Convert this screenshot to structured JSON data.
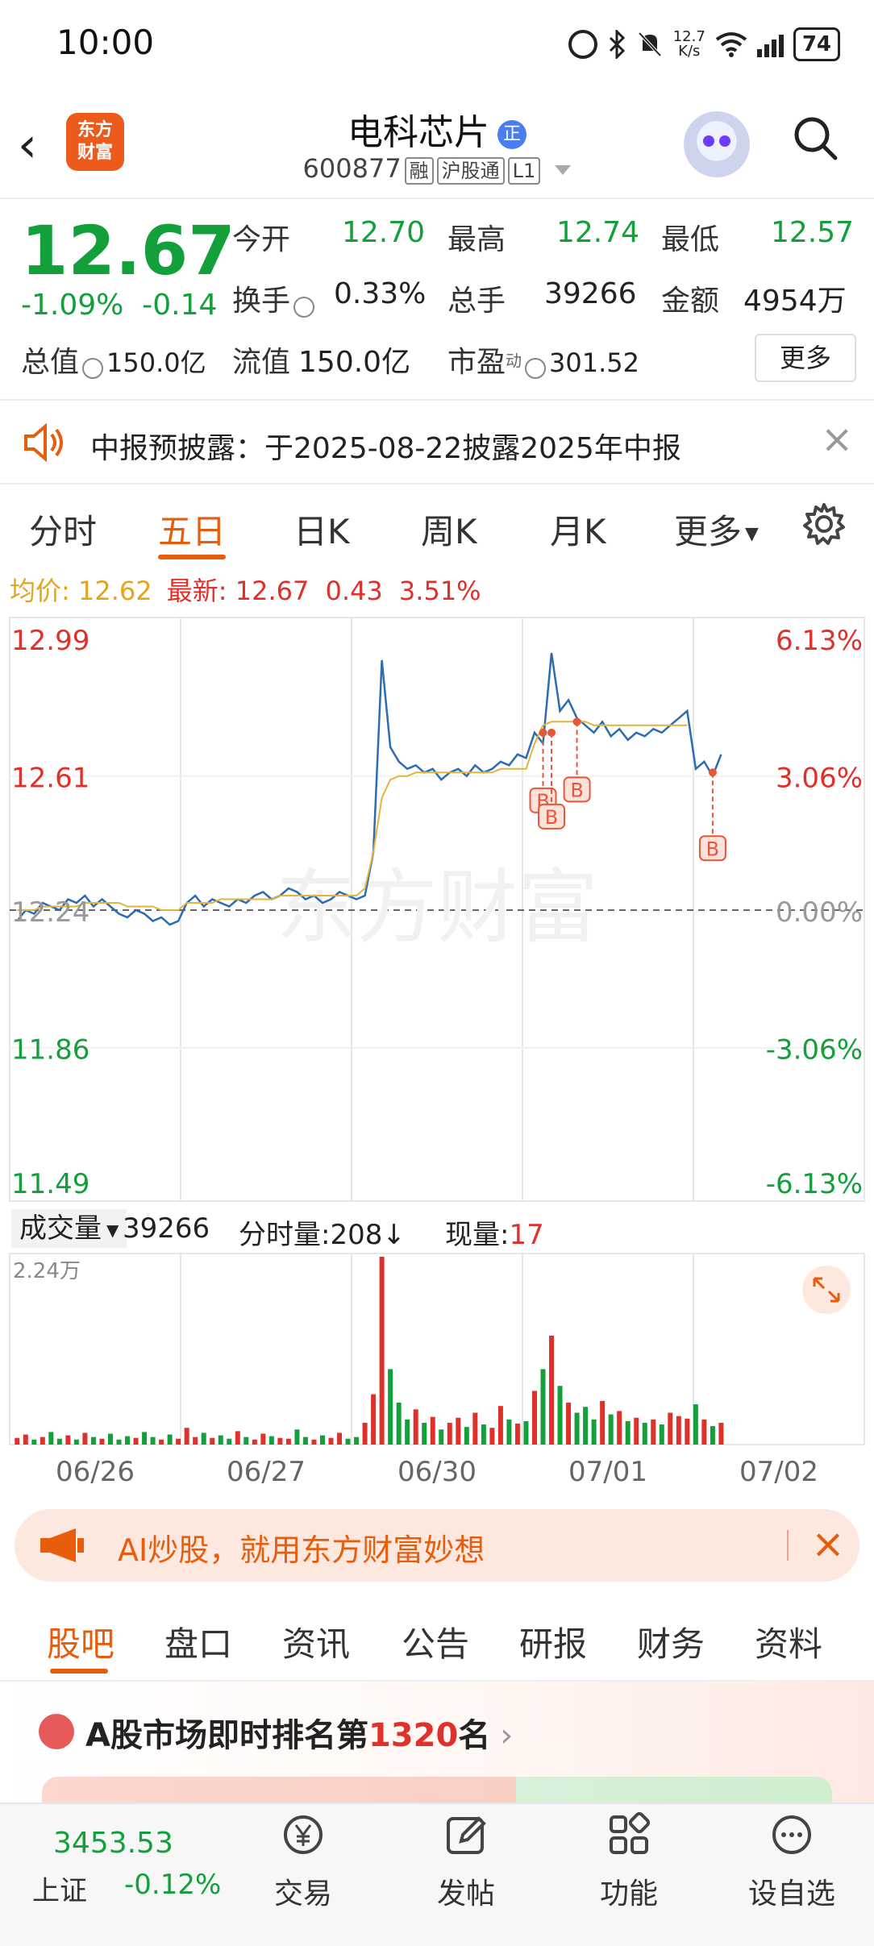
{
  "status_bar": {
    "time": "10:00",
    "speed_top": "12.7",
    "speed_bottom": "K/s",
    "battery": "74"
  },
  "header": {
    "logo_line1": "东方",
    "logo_line2": "财富",
    "stock_name": "电科芯片",
    "badge": "正",
    "stock_code": "600877",
    "tags": [
      "融",
      "沪股通",
      "L1"
    ]
  },
  "quote": {
    "price": "12.67",
    "change_pct": "-1.09%",
    "change_amt": "-0.14",
    "rows": [
      [
        {
          "label": "今开",
          "value": "12.70",
          "color": "green"
        },
        {
          "label": "最高",
          "value": "12.74",
          "color": "green"
        },
        {
          "label": "最低",
          "value": "12.57",
          "color": "green"
        }
      ],
      [
        {
          "label": "换手",
          "value": "0.33%",
          "color": "dark"
        },
        {
          "label": "总手",
          "value": "39266",
          "color": "dark"
        },
        {
          "label": "金额",
          "value": "4954万",
          "color": "dark"
        }
      ]
    ],
    "total_value_label": "总值",
    "total_value": "150.0亿",
    "float_value_label": "流值",
    "float_value": "150.0亿",
    "pe_label": "市盈",
    "pe_sup": "动",
    "pe_value": "301.52",
    "more_label": "更多"
  },
  "notice": {
    "text": "中报预披露：于2025-08-22披露2025年中报"
  },
  "tabs": {
    "items": [
      "分时",
      "五日",
      "日K",
      "周K",
      "月K",
      "更多"
    ],
    "active": "五日"
  },
  "avg_row": {
    "avg_label": "均价:",
    "avg_value": "12.62",
    "latest_label": "最新:",
    "latest_value": "12.67",
    "latest_chg": "0.43",
    "latest_pct": "3.51%"
  },
  "chart_data": {
    "type": "line",
    "y_labels_left": [
      "12.99",
      "12.61",
      "12.24",
      "11.86",
      "11.49"
    ],
    "y_labels_right": [
      "6.13%",
      "3.06%",
      "0.00%",
      "-3.06%",
      "-6.13%"
    ],
    "ylim": [
      11.49,
      12.99
    ],
    "prev_close": 12.24,
    "x_labels": [
      "06/26",
      "06/27",
      "06/30",
      "07/01",
      "07/02"
    ],
    "watermark": "东方财富",
    "series": [
      {
        "values": [
          12.21,
          12.24,
          12.23,
          12.26,
          12.25,
          12.24,
          12.27,
          12.26,
          12.28,
          12.25,
          12.27,
          12.25,
          12.23,
          12.22,
          12.24,
          12.23,
          12.21,
          12.22,
          12.2,
          12.21,
          12.26,
          12.28,
          12.25,
          12.27,
          12.26,
          12.25,
          12.27,
          12.26,
          12.28,
          12.29,
          12.27,
          12.28,
          12.3,
          12.29,
          12.27,
          12.28,
          12.26,
          12.27,
          12.29,
          12.28,
          12.27,
          12.28,
          12.4,
          12.93,
          12.69,
          12.65,
          12.63,
          12.64,
          12.62,
          12.63,
          12.6,
          12.62,
          12.63,
          12.61,
          12.64,
          12.62,
          12.63,
          12.65,
          12.64,
          12.67,
          12.66,
          12.73,
          12.7,
          12.95,
          12.79,
          12.82,
          12.77,
          12.75,
          12.73,
          12.76,
          12.72,
          12.74,
          12.71,
          12.73,
          12.72,
          12.74,
          12.73,
          12.75,
          12.77,
          12.79,
          12.63,
          12.65,
          12.61,
          12.67
        ]
      },
      {
        "values": [
          12.24,
          12.24,
          12.24,
          12.25,
          12.25,
          12.25,
          12.25,
          12.25,
          12.26,
          12.26,
          12.26,
          12.26,
          12.26,
          12.25,
          12.25,
          12.25,
          12.25,
          12.24,
          12.24,
          12.24,
          12.26,
          12.26,
          12.26,
          12.26,
          12.27,
          12.27,
          12.27,
          12.27,
          12.27,
          12.27,
          12.27,
          12.28,
          12.28,
          12.28,
          12.28,
          12.28,
          12.28,
          12.28,
          12.28,
          12.28,
          12.28,
          12.3,
          12.4,
          12.55,
          12.6,
          12.61,
          12.61,
          12.62,
          12.62,
          12.62,
          12.62,
          12.62,
          12.62,
          12.62,
          12.62,
          12.62,
          12.62,
          12.63,
          12.63,
          12.63,
          12.63,
          12.7,
          12.75,
          12.76,
          12.76,
          12.76,
          12.76,
          12.76,
          12.75,
          12.75,
          12.75,
          12.75,
          12.75,
          12.75,
          12.75,
          12.75,
          12.75,
          12.75,
          12.75,
          12.75,
          null,
          null,
          null,
          null
        ]
      }
    ],
    "buy_markers": [
      {
        "index": 62,
        "price": 12.73
      },
      {
        "index": 63,
        "price": 12.73
      },
      {
        "index": 66,
        "price": 12.76
      },
      {
        "index": 82,
        "price": 12.62
      }
    ],
    "buy_marker_label": "B",
    "volume": {
      "label": "成交量",
      "total": "39266",
      "fenshi_label": "分时量:",
      "fenshi_value": "208",
      "fenshi_arrow": "↓",
      "now_label": "现量:",
      "now_value": "17",
      "max_label": "2.24万",
      "values": [
        80,
        120,
        60,
        90,
        150,
        70,
        110,
        60,
        140,
        90,
        70,
        130,
        60,
        100,
        80,
        150,
        90,
        60,
        120,
        70,
        200,
        90,
        140,
        80,
        110,
        70,
        160,
        90,
        60,
        130,
        100,
        80,
        70,
        180,
        90,
        60,
        110,
        80,
        140,
        70,
        90,
        260,
        600,
        2240,
        900,
        500,
        300,
        420,
        260,
        330,
        180,
        260,
        320,
        210,
        380,
        240,
        200,
        460,
        300,
        250,
        280,
        640,
        900,
        1300,
        700,
        500,
        380,
        450,
        300,
        520,
        360,
        400,
        280,
        320,
        260,
        300,
        240,
        380,
        340,
        310,
        480,
        300,
        220,
        260
      ]
    }
  },
  "ai_banner": {
    "text": "AI炒股，就用东方财富妙想"
  },
  "bottom_tabs": {
    "items": [
      "股吧",
      "盘口",
      "资讯",
      "公告",
      "研报",
      "财务",
      "资料"
    ],
    "active": "股吧"
  },
  "rank": {
    "prefix": "A股市场即时排名第",
    "number": "1320",
    "suffix": "名",
    "chevron": "›"
  },
  "bottom_nav": {
    "index_value": "3453.53",
    "index_name": "上证",
    "index_change": "-0.12%",
    "items": [
      {
        "label": "交易",
        "icon": "yen-icon"
      },
      {
        "label": "发帖",
        "icon": "edit-icon"
      },
      {
        "label": "功能",
        "icon": "grid-icon"
      },
      {
        "label": "设自选",
        "icon": "more-icon"
      }
    ]
  }
}
